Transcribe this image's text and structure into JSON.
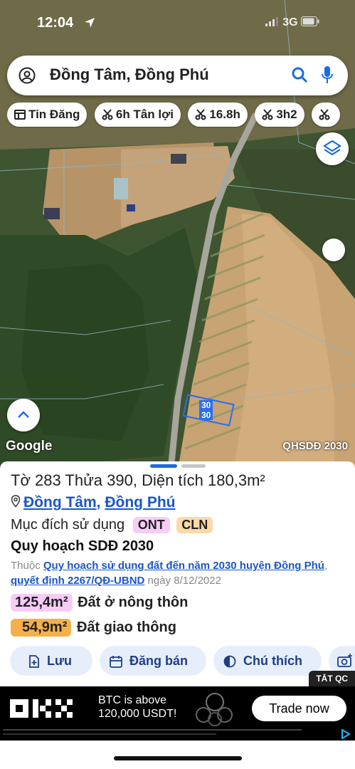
{
  "status_bar": {
    "time": "12:04",
    "network": "3G"
  },
  "search": {
    "title": "Đồng Tâm, Đồng Phú"
  },
  "chips": [
    {
      "label": "Tin Đăng"
    },
    {
      "label": "6h Tân lợi"
    },
    {
      "label": "16.8h"
    },
    {
      "label": "3h2"
    }
  ],
  "map": {
    "google_label": "Google",
    "layer_label": "QHSDĐ 2030",
    "parcel_labels": [
      "30",
      "30"
    ]
  },
  "parcel": {
    "title": "Tờ 283 Thửa 390, Diện tích 180,3m²",
    "commune": "Đồng Tâm",
    "district": "Đồng Phú",
    "purpose_label": "Mục đích sử dụng",
    "purpose_codes": [
      "ONT",
      "CLN"
    ],
    "plan_heading": "Quy hoạch SDĐ 2030",
    "source_prefix": "Thuộc",
    "source_link": "Quy hoạch sử dụng đất đến năm 2030 huyện Đồng Phú",
    "decision_link": "quyết định 2267/QĐ-UBND",
    "decision_date": "ngày 8/12/2022",
    "areas": [
      {
        "value": "125,4m²",
        "label": "Đất ở nông thôn",
        "color": "#f7cdf7"
      },
      {
        "value": "54,9m²",
        "label": "Đất giao thông",
        "color": "#f5b04a"
      }
    ]
  },
  "actions": {
    "save": "Lưu",
    "post": "Đăng bán",
    "legend": "Chú thích"
  },
  "ad": {
    "close_label": "TẮT QC",
    "brand": "OKX",
    "text_line1": "BTC is above",
    "text_line2": "120,000 USDT!",
    "cta": "Trade now"
  },
  "colors": {
    "link": "#1a56c9",
    "accent_blue": "#2a6ef0",
    "button_bg": "#e7eefb"
  }
}
